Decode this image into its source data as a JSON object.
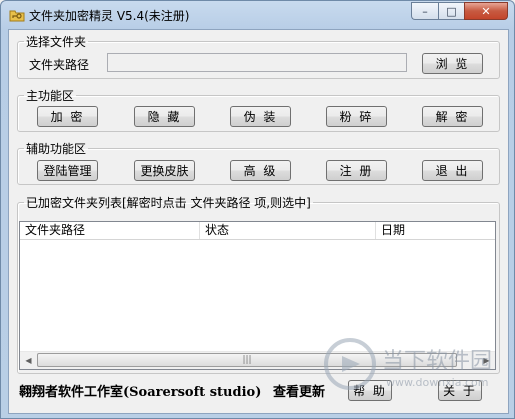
{
  "window": {
    "title": "文件夹加密精灵 V5.4(未注册)",
    "controls": {
      "minimize": "–",
      "maximize": "□",
      "close": "✕"
    }
  },
  "select_folder": {
    "legend": "选择文件夹",
    "path_label": "文件夹路径",
    "path_value": "",
    "browse": "浏 览"
  },
  "main_functions": {
    "legend": "主功能区",
    "buttons": [
      "加 密",
      "隐 藏",
      "伪 装",
      "粉 碎",
      "解 密"
    ]
  },
  "aux_functions": {
    "legend": "辅助功能区",
    "buttons": [
      "登陆管理",
      "更换皮肤",
      "高 级",
      "注 册",
      "退 出"
    ]
  },
  "encrypted_list": {
    "legend": "已加密文件夹列表[解密时点击 文件夹路径 项,则选中]",
    "columns": [
      "文件夹路径",
      "状态",
      "日期"
    ],
    "rows": []
  },
  "footer": {
    "studio": "翱翔者软件工作室(Soarersoft studio)",
    "check_update": "查看更新",
    "help": "帮 助",
    "about": "关 于"
  },
  "watermark": {
    "text": "当下软件园",
    "url": "www.downxia.com"
  },
  "colors": {
    "accent": "#b9cfe6",
    "close_button": "#c4452b"
  }
}
